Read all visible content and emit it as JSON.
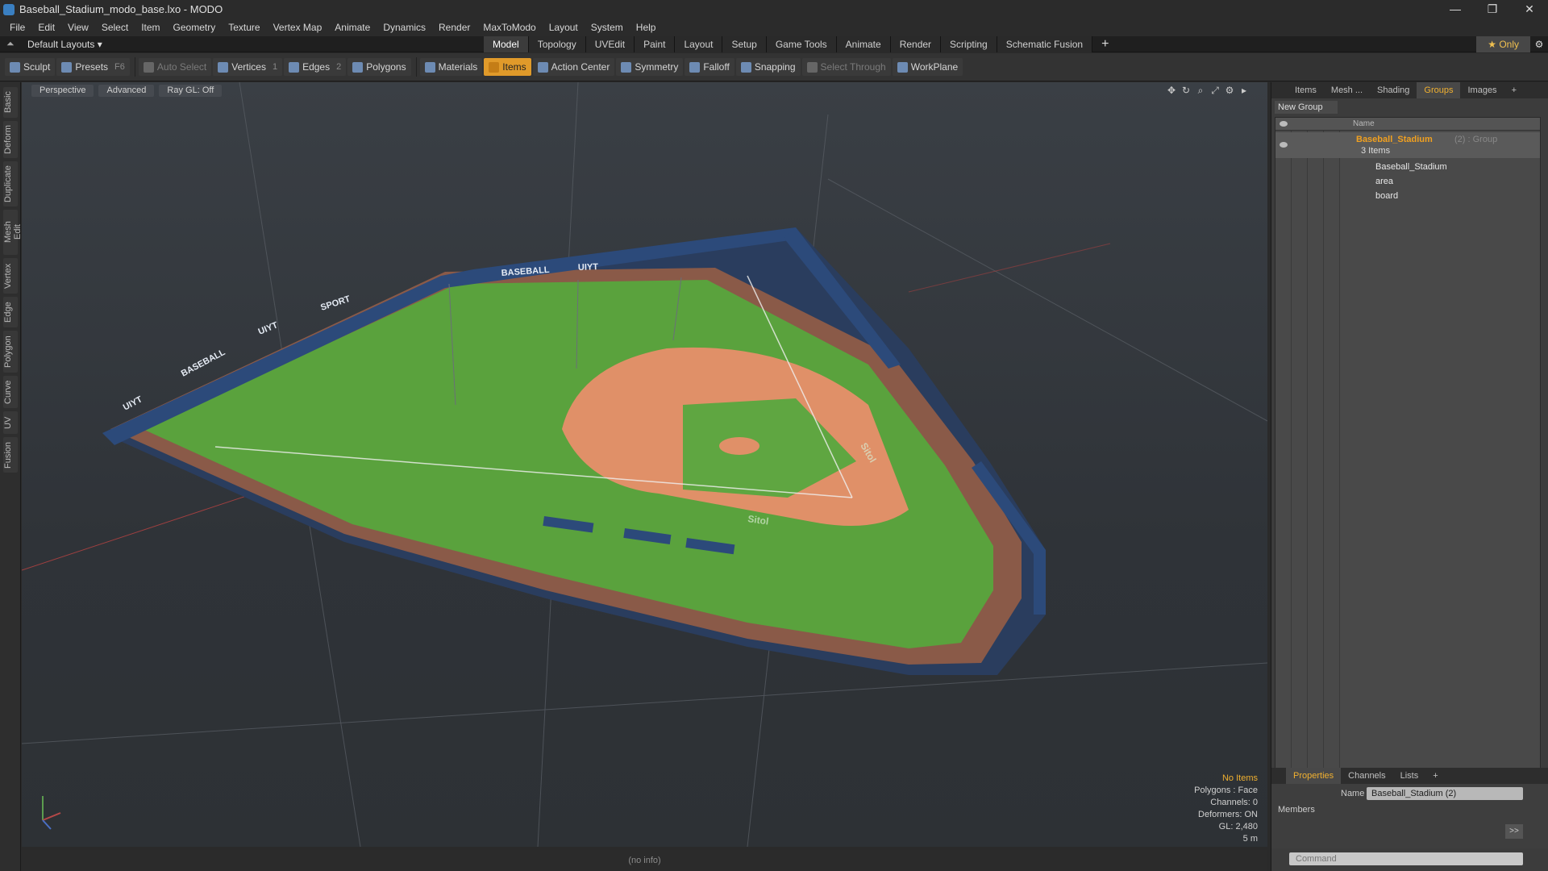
{
  "window": {
    "title": "Baseball_Stadium_modo_base.lxo - MODO",
    "controls": [
      "—",
      "❐",
      "✕"
    ]
  },
  "menu": [
    "File",
    "Edit",
    "View",
    "Select",
    "Item",
    "Geometry",
    "Texture",
    "Vertex Map",
    "Animate",
    "Dynamics",
    "Render",
    "MaxToModo",
    "Layout",
    "System",
    "Help"
  ],
  "layouts": {
    "label": "Default Layouts ▾",
    "tabs": [
      "Model",
      "Topology",
      "UVEdit",
      "Paint",
      "Layout",
      "Setup",
      "Game Tools",
      "Animate",
      "Render",
      "Scripting",
      "Schematic Fusion"
    ],
    "active": "Model",
    "plus": "+",
    "only": "★ Only",
    "gear": "⚙"
  },
  "toolbar": {
    "sculpt": "Sculpt",
    "presets": "Presets",
    "presets_key": "F6",
    "auto_select": "Auto Select",
    "vertices": "Vertices",
    "vertices_n": "1",
    "edges": "Edges",
    "edges_n": "2",
    "polygons": "Polygons",
    "materials": "Materials",
    "items": "Items",
    "action_center": "Action Center",
    "symmetry": "Symmetry",
    "falloff": "Falloff",
    "snapping": "Snapping",
    "select_through": "Select Through",
    "workplane": "WorkPlane"
  },
  "left_tabs": [
    "Basic",
    "Deform",
    "Duplicate",
    "Mesh Edit",
    "Vertex",
    "Edge",
    "Polygon",
    "Curve",
    "UV",
    "Fusion"
  ],
  "viewport": {
    "buttons": [
      "Perspective",
      "Advanced",
      "Ray GL: Off"
    ],
    "stats": {
      "noitems": "No Items",
      "polygons": "Polygons : Face",
      "channels": "Channels: 0",
      "deformers": "Deformers: ON",
      "gl": "GL: 2,480",
      "scale": "5 m"
    },
    "scene": {
      "wall_texts": [
        "UIYT",
        "BASEBALL",
        "UIYT",
        "SPORT",
        "BASEBALL",
        "UIYT"
      ],
      "field_texts": [
        "Sitol",
        "Sitol"
      ],
      "colors": {
        "grass": "#5aa23d",
        "dirt": "#e09068",
        "track": "#8a5a48",
        "wall": "#2c4a7a"
      }
    }
  },
  "statusbar": "(no info)",
  "right_panel": {
    "tabs": [
      "Items",
      "Mesh ...",
      "Shading",
      "Groups",
      "Images",
      "+"
    ],
    "active_tab": "Groups",
    "new_group": "New Group",
    "col_name": "Name",
    "group": {
      "name": "Baseball_Stadium",
      "suffix": "(2) : Group",
      "count": "3 Items"
    },
    "items": [
      "Baseball_Stadium",
      "area",
      "board"
    ]
  },
  "properties": {
    "tabs": [
      "Properties",
      "Channels",
      "Lists",
      "+"
    ],
    "active": "Properties",
    "name_label": "Name",
    "name_value": "Baseball_Stadium (2)",
    "members": "Members",
    "arrow": ">>"
  },
  "command": {
    "placeholder": "Command"
  }
}
